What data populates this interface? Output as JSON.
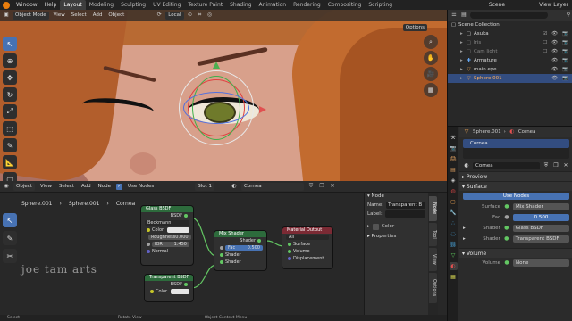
{
  "menu": [
    "Window",
    "Help"
  ],
  "workspaces": [
    "Layout",
    "Modeling",
    "Sculpting",
    "UV Editing",
    "Texture Paint",
    "Shading",
    "Animation",
    "Rendering",
    "Compositing",
    "Scripting"
  ],
  "active_workspace": "Layout",
  "scene": "Scene",
  "view_layer": "View Layer",
  "viewport": {
    "mode": "Object Mode",
    "menus": [
      "View",
      "Select",
      "Add",
      "Object"
    ],
    "orientation": "Local",
    "options_label": "Options"
  },
  "node_editor": {
    "type": "Object",
    "menus": [
      "View",
      "Select",
      "Add",
      "Node"
    ],
    "use_nodes_label": "Use Nodes",
    "slot": "Slot 1",
    "material": "Cornea",
    "breadcrumb": [
      "Sphere.001",
      "Sphere.001",
      "Cornea"
    ],
    "watermark": "joe tam arts",
    "nodes": {
      "glass": {
        "title": "Glass BSDF",
        "output": "BSDF",
        "distribution": "Beckmann",
        "color_label": "Color",
        "roughness_label": "Roughness",
        "roughness_value": "0.000",
        "ior_label": "IOR",
        "ior_value": "1.450",
        "normal_label": "Normal"
      },
      "transparent": {
        "title": "Transparent BSDF",
        "output": "BSDF",
        "color_label": "Color"
      },
      "mix": {
        "title": "Mix Shader",
        "output": "Shader",
        "fac_label": "Fac",
        "fac_value": "0.500",
        "shader1": "Shader",
        "shader2": "Shader"
      },
      "output": {
        "title": "Material Output",
        "target": "All",
        "surface": "Surface",
        "volume": "Volume",
        "displacement": "Displacement"
      }
    },
    "npanel": {
      "node_section": "Node",
      "name_label": "Name:",
      "name_value": "Transparent B",
      "label_label": "Label:",
      "color_label": "Color",
      "properties_section": "Properties"
    },
    "tabs": [
      "Node",
      "Tool",
      "View",
      "Options"
    ]
  },
  "outliner": {
    "rows": [
      {
        "label": "Scene Collection",
        "indent": 0,
        "selected": false
      },
      {
        "label": "Asuka",
        "indent": 1,
        "selected": false
      },
      {
        "label": "Iris",
        "indent": 1,
        "selected": false
      },
      {
        "label": "Cam light",
        "indent": 1,
        "selected": false
      },
      {
        "label": "Armature",
        "indent": 1,
        "selected": false
      },
      {
        "label": "main eye",
        "indent": 1,
        "selected": false
      },
      {
        "label": "Sphere.001",
        "indent": 1,
        "selected": true
      }
    ]
  },
  "properties": {
    "object": "Sphere.001",
    "material": "Cornea",
    "slot_item": "Cornea",
    "material_field": "Cornea",
    "preview_section": "Preview",
    "surface_section": "Surface",
    "use_nodes_button": "Use Nodes",
    "surface_label": "Surface",
    "surface_value": "Mix Shader",
    "fac_label": "Fac",
    "fac_value": "0.500",
    "shader1_label": "Shader",
    "shader1_value": "Glass BSDF",
    "shader2_label": "Shader",
    "shader2_value": "Transparent BSDF",
    "volume_section": "Volume",
    "volume_label": "Volume",
    "volume_value": "None"
  },
  "statusbar": [
    "Select",
    "Rotate View",
    "Object Context Menu"
  ]
}
